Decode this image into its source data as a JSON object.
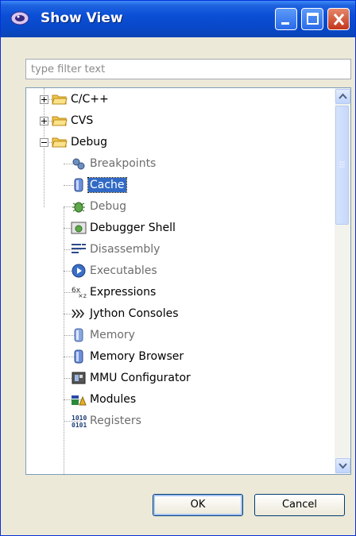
{
  "window": {
    "title": "Show View"
  },
  "filter": {
    "placeholder": "type filter text",
    "value": ""
  },
  "tree": {
    "categories": [
      {
        "label": "C/C++",
        "expanded": false
      },
      {
        "label": "CVS",
        "expanded": false
      },
      {
        "label": "Debug",
        "expanded": true
      }
    ],
    "debug_views": [
      {
        "label": "Breakpoints",
        "icon": "breakpoints-icon",
        "enabled": false
      },
      {
        "label": "Cache",
        "icon": "cache-icon",
        "enabled": true,
        "selected": true
      },
      {
        "label": "Debug",
        "icon": "debug-bug-icon",
        "enabled": false
      },
      {
        "label": "Debugger Shell",
        "icon": "debugger-shell-icon",
        "enabled": true
      },
      {
        "label": "Disassembly",
        "icon": "disassembly-icon",
        "enabled": false
      },
      {
        "label": "Executables",
        "icon": "executables-icon",
        "enabled": false
      },
      {
        "label": "Expressions",
        "icon": "expressions-icon",
        "enabled": true
      },
      {
        "label": "Jython Consoles",
        "icon": "jython-icon",
        "enabled": true
      },
      {
        "label": "Memory",
        "icon": "memory-icon",
        "enabled": false
      },
      {
        "label": "Memory Browser",
        "icon": "memory-browser-icon",
        "enabled": true
      },
      {
        "label": "MMU Configurator",
        "icon": "mmu-icon",
        "enabled": true
      },
      {
        "label": "Modules",
        "icon": "modules-icon",
        "enabled": true
      },
      {
        "label": "Registers",
        "icon": "registers-icon",
        "enabled": false
      }
    ]
  },
  "buttons": {
    "ok": "OK",
    "cancel": "Cancel"
  },
  "colors": {
    "titlebar": "#0a4fd6",
    "selection": "#316ac5",
    "dialog_bg": "#ece9d8",
    "folder": "#f2c64a"
  }
}
